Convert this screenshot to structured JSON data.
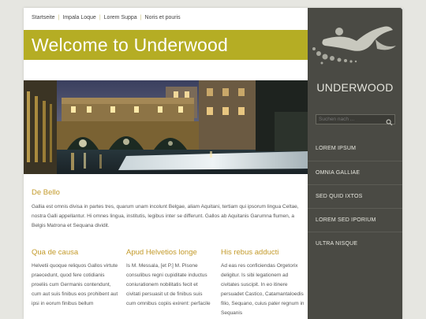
{
  "breadcrumb": {
    "items": [
      "Startseite",
      "Impala Loque",
      "Lorem Suppa",
      "Noris et pouris"
    ]
  },
  "banner": {
    "title": "Welcome to Underwood"
  },
  "intro": {
    "title": "De Bello",
    "text": "Gallia est omnis divisa in partes tres, quarum unam incolunt Belgae, aliam Aquitani, tertiam qui ipsorum lingua Celtae, nostra Galli appellantur. Hi omnes lingua, institutis, legibus inter se differunt. Gallos ab Aquitanis Garumna flumen, a Belgis Matrona et Sequana dividit."
  },
  "columns": [
    {
      "title": "Qua de causa",
      "text": "Helvetii quoque reliquos Gallos virtute praecedunt, quod fere cotidianis proeliis cum Germanis contendunt, cum aut suis finibus eos prohibent aut ipsi in eorum finibus bellum"
    },
    {
      "title": "Apud Helvetios longe",
      "text": "Is M. Messala, [et P.] M. Pisone consulibus regni cupiditate inductus coniurationem nobilitatis fecit et civitati persuasit ut de finibus suis cum omnibus copiis exirent: perfacile"
    },
    {
      "title": "His rebus adducti",
      "text": "Ad eas res conficiendas Orgetorix deligitur. Is sibi legationem ad civitates suscipit. In eo itinere persuadet Castico, Catamantaloedis filio, Sequano, cuius pater regnum in Sequanis"
    }
  ],
  "sidebar": {
    "logo_text": "UNDERWOOD",
    "search_placeholder": "Suchen nach ...",
    "menu": [
      "LOREM IPSUM",
      "OMNIA GALLIAE",
      "SED QUID IXTOS",
      "LOREM SED IPORIUM",
      "ULTRA NISQUE"
    ]
  },
  "colors": {
    "accent": "#b5ad24",
    "heading": "#c39a2a",
    "sidebar": "#4a4a44"
  },
  "icons": {
    "search": "search-icon",
    "logo": "swimmer-logo-icon"
  }
}
